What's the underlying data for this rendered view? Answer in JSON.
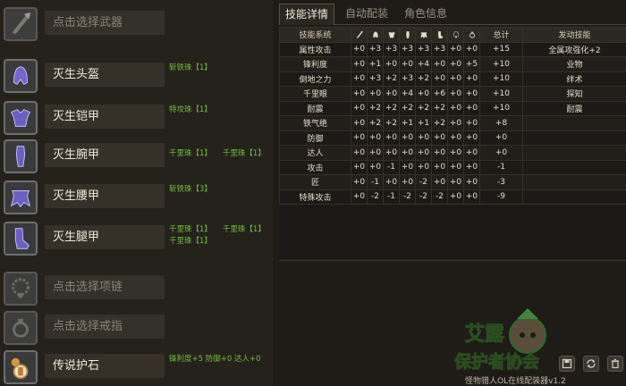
{
  "equipment": [
    {
      "name": "点击选择武器",
      "placeholder": true,
      "icon": "weapon-icon",
      "jewels": []
    },
    {
      "name": "灭生头盔",
      "placeholder": false,
      "icon": "helmet-icon",
      "jewels": [
        "斩铁珠【1】"
      ]
    },
    {
      "name": "灭生铠甲",
      "placeholder": false,
      "icon": "chest-armor-icon",
      "jewels": [
        "特攻珠【1】"
      ]
    },
    {
      "name": "灭生腕甲",
      "placeholder": false,
      "icon": "arm-armor-icon",
      "jewels": [
        "千里珠【1】",
        "千里珠【1】"
      ]
    },
    {
      "name": "灭生腰甲",
      "placeholder": false,
      "icon": "waist-armor-icon",
      "jewels": [
        "斩铁珠【3】"
      ]
    },
    {
      "name": "灭生腿甲",
      "placeholder": false,
      "icon": "leg-armor-icon",
      "jewels": [
        "千里珠【1】",
        "千里珠【1】",
        "千里珠【1】"
      ]
    },
    {
      "name": "点击选择项链",
      "placeholder": true,
      "icon": "necklace-icon",
      "jewels": []
    },
    {
      "name": "点击选择戒指",
      "placeholder": true,
      "icon": "ring-icon",
      "jewels": []
    },
    {
      "name": "传说护石",
      "placeholder": false,
      "icon": "talisman-icon",
      "jewels": [
        "锋利度+5 防御+0 达人+0"
      ]
    }
  ],
  "tabs": [
    {
      "label": "技能详情",
      "active": true
    },
    {
      "label": "自动配装",
      "active": false
    },
    {
      "label": "角色信息",
      "active": false
    }
  ],
  "table": {
    "headers": [
      "技能系统",
      "weapon-icon",
      "helmet-icon",
      "chest-armor-icon",
      "arm-armor-icon",
      "waist-armor-icon",
      "leg-armor-icon",
      "necklace-icon",
      "ring-icon",
      "总计",
      "发动技能"
    ],
    "rows": [
      [
        "属性攻击",
        "+0",
        "+3",
        "+3",
        "+3",
        "+3",
        "+3",
        "+0",
        "+0",
        "+15",
        "全属攻强化+2"
      ],
      [
        "锋利度",
        "+0",
        "+1",
        "+0",
        "+0",
        "+4",
        "+0",
        "+0",
        "+5",
        "+10",
        "业物"
      ],
      [
        "倒地之力",
        "+0",
        "+3",
        "+2",
        "+3",
        "+2",
        "+0",
        "+0",
        "+0",
        "+10",
        "绊术"
      ],
      [
        "千里眼",
        "+0",
        "+0",
        "+0",
        "+4",
        "+0",
        "+6",
        "+0",
        "+0",
        "+10",
        "探知"
      ],
      [
        "耐震",
        "+0",
        "+2",
        "+2",
        "+2",
        "+2",
        "+2",
        "+0",
        "+0",
        "+10",
        "耐震"
      ],
      [
        "铁气绝",
        "+0",
        "+2",
        "+2",
        "+1",
        "+1",
        "+2",
        "+0",
        "+0",
        "+8",
        ""
      ],
      [
        "防御",
        "+0",
        "+0",
        "+0",
        "+0",
        "+0",
        "+0",
        "+0",
        "+0",
        "+0",
        ""
      ],
      [
        "达人",
        "+0",
        "+0",
        "+0",
        "+0",
        "+0",
        "+0",
        "+0",
        "+0",
        "+0",
        ""
      ],
      [
        "攻击",
        "+0",
        "+0",
        "-1",
        "+0",
        "+0",
        "+0",
        "+0",
        "+0",
        "-1",
        ""
      ],
      [
        "匠",
        "+0",
        "-1",
        "+0",
        "+0",
        "-2",
        "+0",
        "+0",
        "+0",
        "-3",
        ""
      ],
      [
        "特殊攻击",
        "+0",
        "-2",
        "-1",
        "-2",
        "-2",
        "-2",
        "+0",
        "+0",
        "-9",
        ""
      ]
    ]
  },
  "logo": {
    "line1": "艾露",
    "line2": "保护者协会"
  },
  "version": "怪物猎人OL在线配装器v1.2",
  "buttons": [
    {
      "icon": "save-icon"
    },
    {
      "icon": "refresh-icon"
    },
    {
      "icon": "trash-icon"
    }
  ],
  "colors": {
    "jewel_text": "#6fbf3a",
    "logo_green": "#7ec34a"
  }
}
